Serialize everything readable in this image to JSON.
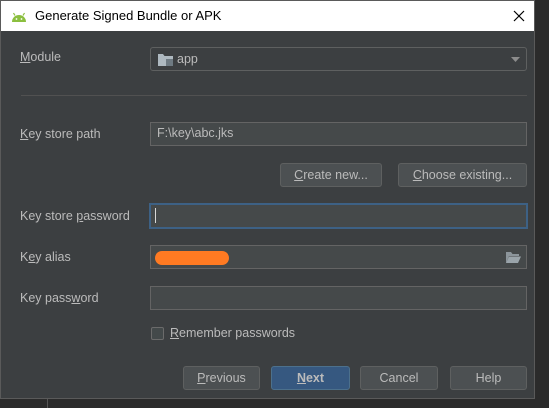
{
  "window": {
    "title": "Generate Signed Bundle or APK",
    "app_icon": "android-icon",
    "close_icon": "close-icon"
  },
  "module": {
    "label_mn": "M",
    "label_rest": "odule",
    "value": "app",
    "icon": "folder-icon"
  },
  "keystore_path": {
    "label_mn": "K",
    "label_rest": "ey store path",
    "value": "F:\\key\\abc.jks"
  },
  "buttons_keystore": {
    "create_mn": "C",
    "create_rest": "reate new...",
    "choose_mn": "C",
    "choose_rest": "hoose existing..."
  },
  "keystore_password": {
    "label_pre": "Key store ",
    "label_mn": "p",
    "label_rest": "assword",
    "value": ""
  },
  "key_alias": {
    "label_pre": "K",
    "label_mn": "e",
    "label_rest": "y alias",
    "value": "",
    "redacted": true,
    "browse_icon": "folder-open-icon"
  },
  "key_password": {
    "label_pre": "Key pass",
    "label_mn": "w",
    "label_rest": "ord",
    "value": ""
  },
  "remember": {
    "label_mn": "R",
    "label_rest": "emember passwords",
    "checked": false
  },
  "footer": {
    "previous_mn": "P",
    "previous_rest": "revious",
    "next_mn": "N",
    "next_rest": "ext",
    "cancel": "Cancel",
    "help": "Help"
  },
  "colors": {
    "dialog_bg": "#3c3f41",
    "field_bg": "#45494a",
    "primary_button": "#365880",
    "focus_border": "#3d6185",
    "redaction": "#ff7a22"
  }
}
